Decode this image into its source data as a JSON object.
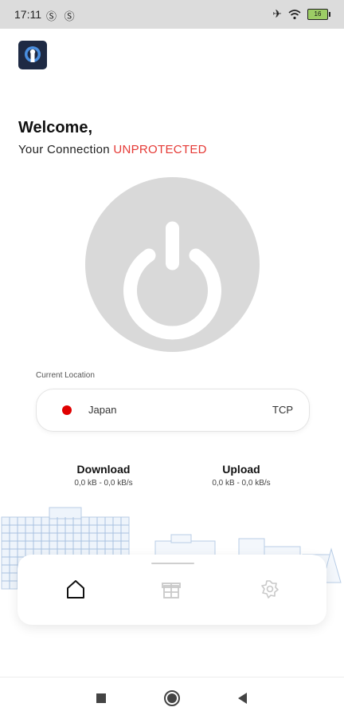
{
  "status_bar": {
    "time": "17:11",
    "left_icons": "Ⓢ Ⓢ",
    "battery": "16"
  },
  "main": {
    "welcome": "Welcome,",
    "connection_prefix": "Your Connection",
    "connection_status": "UNPROTECTED",
    "status_color": "#e53935"
  },
  "location": {
    "label": "Current Location",
    "country": "Japan",
    "protocol": "TCP",
    "flag_color": "#e00000"
  },
  "stats": {
    "download_title": "Download",
    "download_value": "0,0 kB - 0,0 kB/s",
    "upload_title": "Upload",
    "upload_value": "0,0 kB - 0,0 kB/s"
  },
  "bottom_nav": [
    {
      "name": "home",
      "icon": "home-icon",
      "active": true
    },
    {
      "name": "gift",
      "icon": "gift-icon",
      "active": false
    },
    {
      "name": "settings",
      "icon": "settings-icon",
      "active": false
    }
  ],
  "system_nav": [
    "recents-button",
    "home-button",
    "back-button"
  ]
}
